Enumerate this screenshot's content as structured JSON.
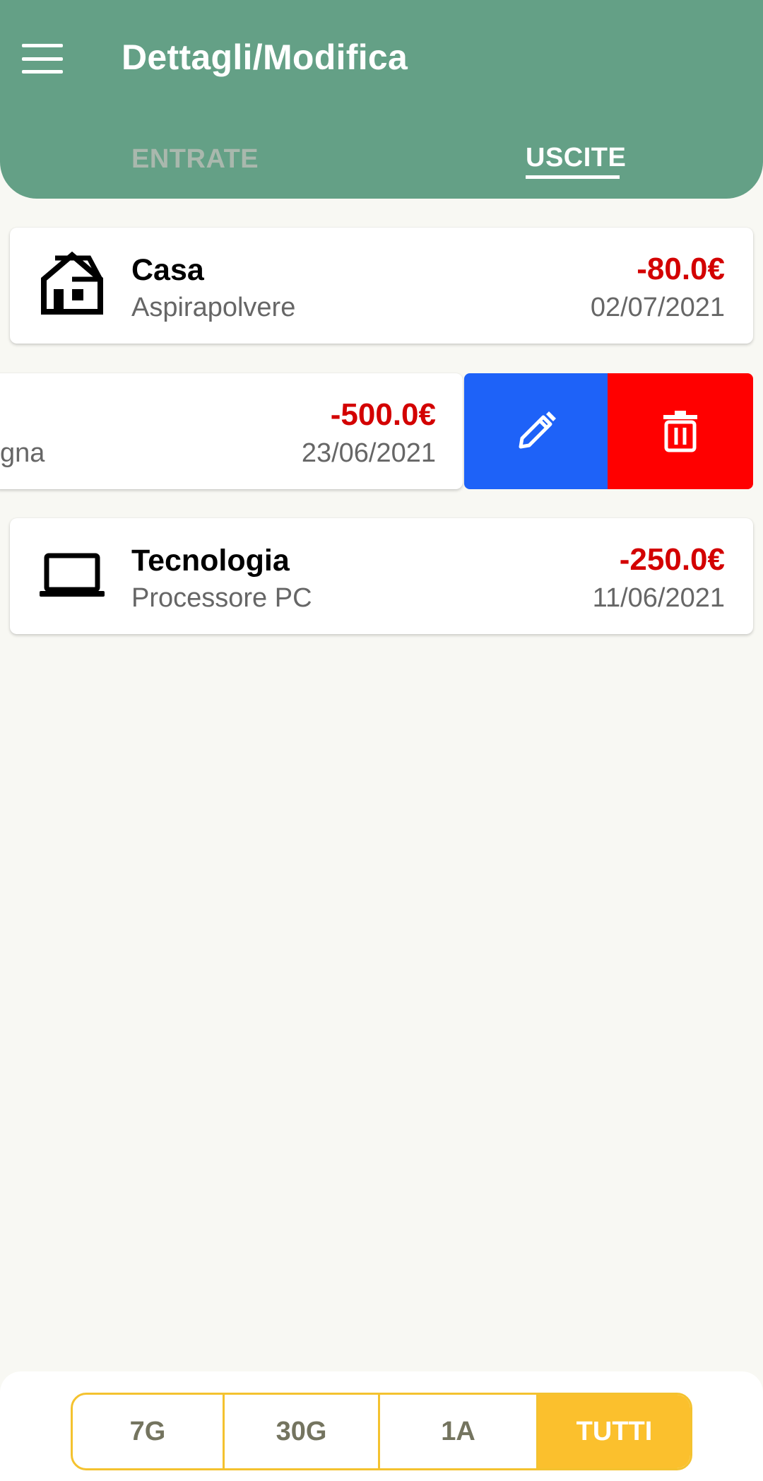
{
  "header": {
    "title": "Dettagli/Modifica",
    "tabs": [
      {
        "label": "ENTRATE",
        "selected": false
      },
      {
        "label": "USCITE",
        "selected": true
      }
    ]
  },
  "transactions": [
    {
      "category": "Casa",
      "description": "Aspirapolvere",
      "amount": "-80.0€",
      "date": "02/07/2021",
      "icon": "house-icon"
    },
    {
      "category": "",
      "description": "gna",
      "amount": "-500.0€",
      "date": "23/06/2021",
      "icon": "",
      "swiped_open": true
    },
    {
      "category": "Tecnologia",
      "description": "Processore PC",
      "amount": "-250.0€",
      "date": "11/06/2021",
      "icon": "laptop-icon"
    }
  ],
  "swipe_actions": {
    "edit_icon": "pencil-icon",
    "delete_icon": "trash-icon"
  },
  "filter": {
    "options": [
      "7G",
      "30G",
      "1A",
      "TUTTI"
    ],
    "selected": "TUTTI"
  },
  "colors": {
    "appbar": "#64a086",
    "amount_negative": "#d30000",
    "edit_action": "#1e62f8",
    "delete_action": "#ff0000",
    "filter_accent": "#fbc02d",
    "background": "#f8f8f3"
  }
}
